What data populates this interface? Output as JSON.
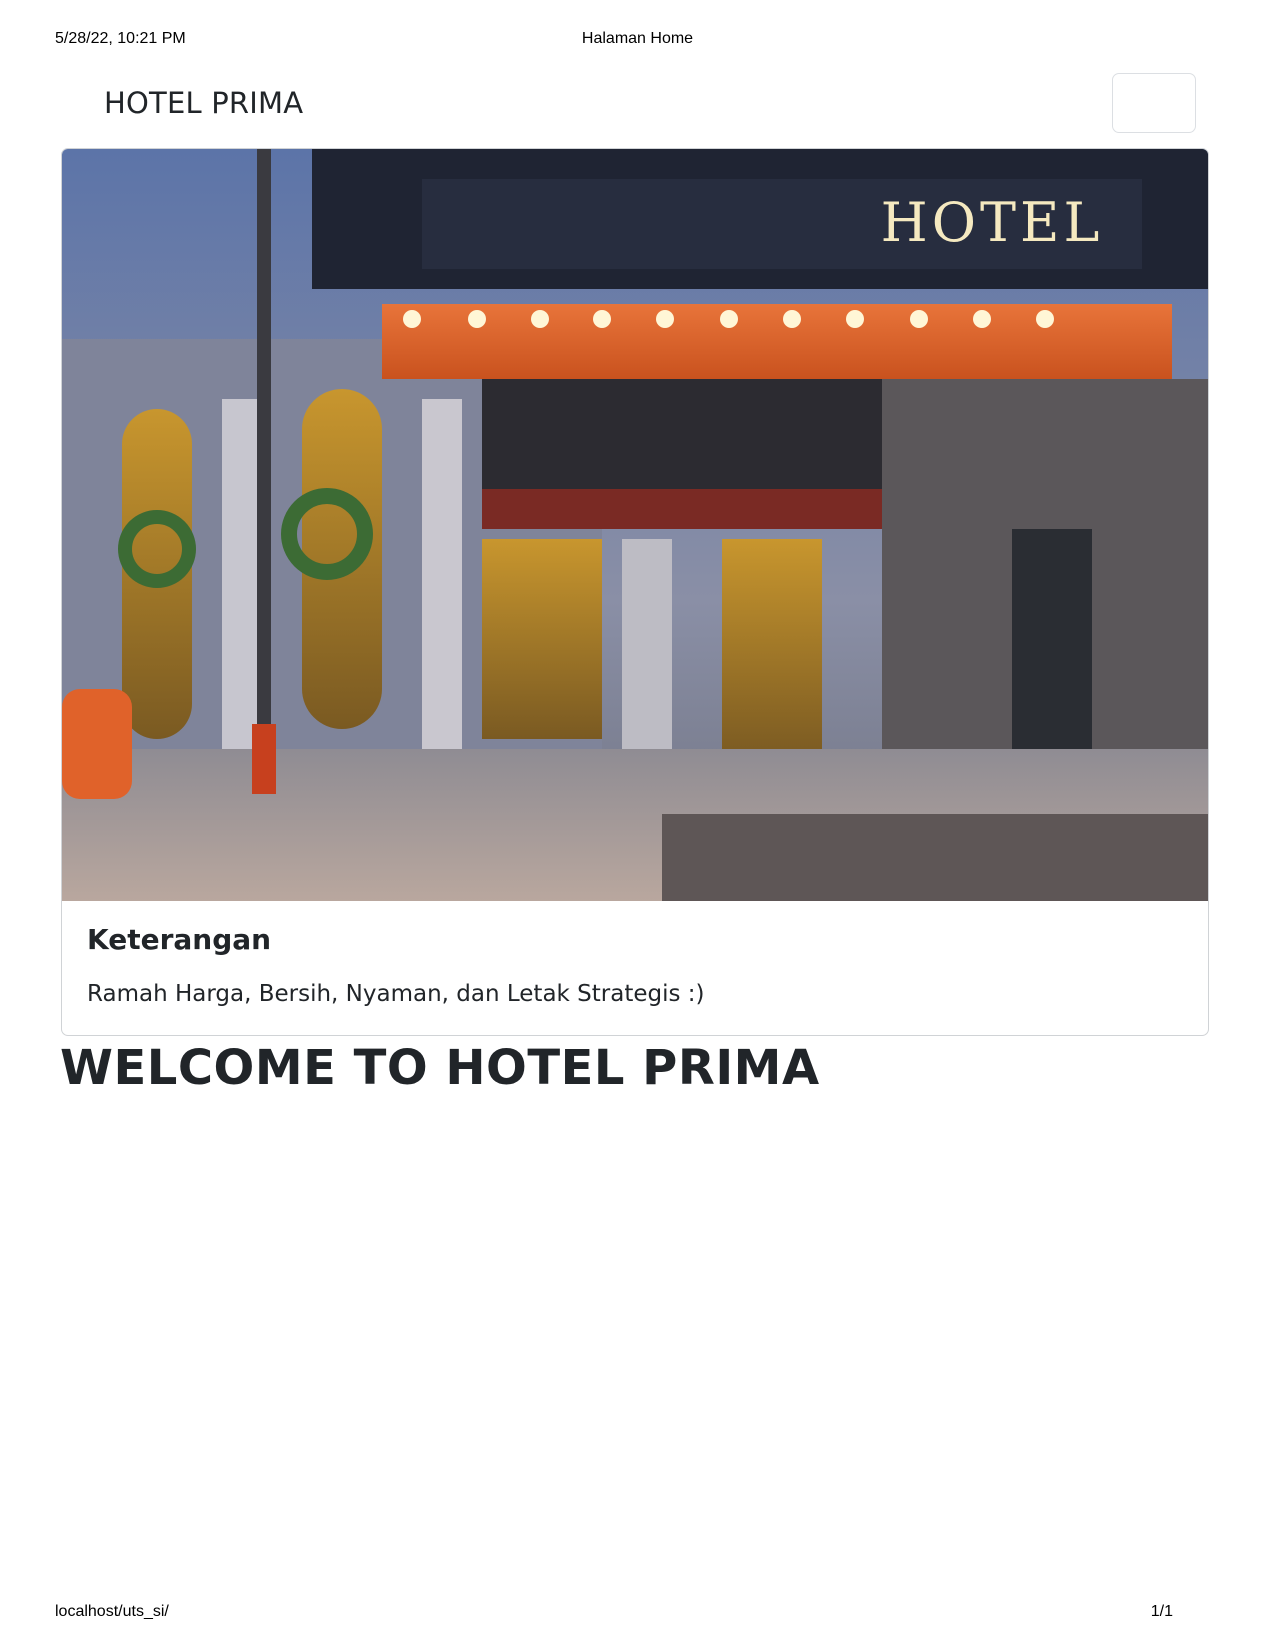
{
  "print_header": {
    "datetime": "5/28/22, 10:21 PM",
    "title": "Halaman Home"
  },
  "print_footer": {
    "url": "localhost/uts_si/",
    "page": "1/1"
  },
  "navbar": {
    "brand": "HOTEL PRIMA"
  },
  "card": {
    "image_sign_text": "HOTEL",
    "title": "Keterangan",
    "text": "Ramah Harga, Bersih, Nyaman, dan Letak Strategis :)"
  },
  "main": {
    "heading": "WELCOME TO HOTEL PRIMA"
  },
  "colors": {
    "text": "#212529",
    "border": "#d0d3d6",
    "canopy_orange": "#e0622a",
    "sky": "#3d5a8f"
  }
}
